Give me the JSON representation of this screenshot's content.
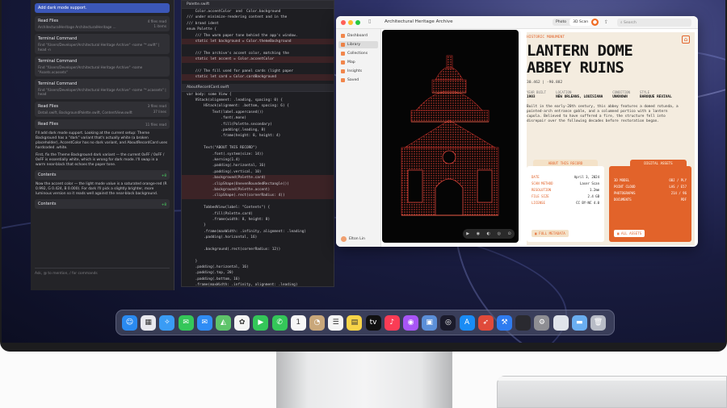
{
  "chat": {
    "prompt": "Add dark mode support.",
    "cards": [
      {
        "title": "Read Files",
        "meta": "4 files read",
        "code": "ArchitecturalHeritage ArchitecturalHeritage ...",
        "meta2": "1 items"
      },
      {
        "title": "Terminal Command",
        "code": "Find \"/Users/Developer/Architectural Heritage Archive\" -name \"*.swift\" | head -n"
      },
      {
        "title": "Terminal Command",
        "code": "Find \"/Users/Developer/Architectural Heritage Archive\" -name \"Assets.xcassets\""
      },
      {
        "title": "Terminal Command",
        "code": "Find \"/Users/Developer/Architectural Heritage Archive\" -name \"*.xcassets\" | head"
      },
      {
        "title": "Read Files",
        "meta": "3 files read",
        "code": "Detail.swift, BackgroundPalette.swift, ContentView.swift",
        "meta2": "37 lines"
      },
      {
        "title": "Read Files",
        "meta": "11 files read"
      }
    ],
    "para1": "I'll add dark mode support. Looking at the current setup: Theme Background has a \"dark\" variant that's actually white (a broken placeholder), AccentColor has no dark variant, and AboutRecordCard uses hardcoded .white.",
    "para2": "First, fix the Theme Background dark variant — the current 0xFF / 0xFF / 0xFF is essentially white, which is wrong for dark mode. I'll swap in a warm near-black that echoes the paper tone.",
    "contents1": "Contents",
    "contents1_meta": "+8",
    "para3": "Now the accent color — the light mode value is a saturated orange-red (R 0.992, G 0.424, B 0.000). For dark I'll pick a slightly brighter, more luminous version so it reads well against the near-black background.",
    "contents2": "Contents",
    "contents2_meta": "+8",
    "input_placeholder": "Ask, @ to mention, / for commands"
  },
  "editor": {
    "tab1": "Palette.swift",
    "tab2": "AboutRecordCard.swift",
    "lines1": [
      "    Color.accentColor  and  Color.background",
      "/// under minimize-rendering content and in the",
      "/// brand ident",
      "enum Palette {",
      "    /// The warm paper tone behind the app's window.",
      "    static let background = Color.themeBackground",
      "",
      "    /// The archive's accent color, matching the",
      "    static let accent = Color.accentColor",
      "",
      "    /// The fill used for panel cards (light paper",
      "    static let card = Color.cardBackground"
    ],
    "lines2": [
      "var body: some View {",
      "    VStack(alignment: .leading, spacing: 0) {",
      "        HStack(alignment: .bottom, spacing: 6) {",
      "            Text(label.uppercased())",
      "                .font(.mono)",
      "                .fill(Palette.secondary)",
      "                .padding(.leading, 8)",
      "                .frame(height: 8, height: 4)",
      "",
      "        Text(\"ABOUT THIS RECORD\")",
      "            .font(.system(size: 14))",
      "            .kerning(1.4)",
      "            .padding(.horizontal, 16)",
      "            .padding(.vertical, 10)",
      "            .background(Palette.card)",
      "            .clipShape(UnevenRoundedRectangle())",
      "            .background(Palette.accent)",
      "            .clipShape(.rect(cornerRadius: 4))",
      "",
      "        TabbedView(label: \"Contents\") {",
      "            .fill(Palette.card)",
      "            .frame(width: 8, height: 8)",
      "        }",
      "        .frame(maxWidth: .infinity, alignment: .leading)",
      "        .padding(.horizontal, 16)",
      "",
      "        .background(.rect(cornerRadius: 12))",
      "",
      "    }",
      "    .padding(.horizontal, 16)",
      "    .padding(.top, 20)",
      "    .padding(.bottom, 16)",
      "    .frame(maxWidth: .infinity, alignment: .leading)",
      "    .background(Palette.card)",
      "    .background(Palette.accent)",
      "}",
      ".foregroundStyle(.fill)"
    ]
  },
  "window": {
    "title": "Architectural Heritage Archive",
    "seg_photo": "Photo",
    "seg_scan": "3D Scan",
    "search_placeholder": "Search",
    "sidebar": [
      "Dashboard",
      "Library",
      "Collections",
      "Map",
      "Insights",
      "Saved"
    ],
    "user": "Elton Lin",
    "tools": [
      "▶",
      "◉",
      "◐",
      "◎",
      "⊙"
    ]
  },
  "detail": {
    "kicker": "HISTORIC MONUMENT",
    "title_line1": "LANTERN DOME",
    "title_line2": "ABBEY RUINS",
    "coord": "30.462 | -90.882",
    "meta": [
      {
        "k": "YEAR BUILT",
        "v": "1903"
      },
      {
        "k": "LOCATION",
        "v": "NEW ORLEANS, LOUISIANA"
      },
      {
        "k": "CONDITION",
        "v": "UNKNOWN"
      },
      {
        "k": "STYLE",
        "v": "BAROQUE REVIVAL"
      }
    ],
    "description": "Built in the early-20th century, this abbey features a domed rotunda, a pointed-arch entrance gable, and a columned portico with a lantern cupola. Believed to have suffered a fire, the structure fell into disrepair over the following decades before restoration began.",
    "about_tab": "ABOUT THIS RECORD",
    "about_rows": [
      {
        "k": "DATE",
        "v": "April 3, 2024"
      },
      {
        "k": "SCAN METHOD",
        "v": "Laser Scan"
      },
      {
        "k": "RESOLUTION",
        "v": "1.2mm"
      },
      {
        "k": "FILE SIZE",
        "v": "2.4 GB"
      },
      {
        "k": "LICENSE",
        "v": "CC BY-NC 4.0"
      }
    ],
    "about_button": "FULL METADATA",
    "assets_tab": "DIGITAL ASSETS",
    "assets_rows": [
      {
        "k": "3D MODEL",
        "v": "OBJ / PLY"
      },
      {
        "k": "POINT CLOUD",
        "v": "LAS / E57"
      },
      {
        "k": "PHOTOGRAPHS",
        "v": "214 / 96"
      },
      {
        "k": "DOCUMENTS",
        "v": "PDF"
      }
    ],
    "assets_button": "ALL ASSETS"
  },
  "dock": {
    "apps": [
      {
        "name": "finder-icon",
        "glyph": "☺",
        "color": "#2a8af0"
      },
      {
        "name": "launchpad-icon",
        "glyph": "▦",
        "color": "#e8e8ee"
      },
      {
        "name": "safari-icon",
        "glyph": "✧",
        "color": "#3a9cf5"
      },
      {
        "name": "messages-icon",
        "glyph": "✉",
        "color": "#34c759"
      },
      {
        "name": "mail-icon",
        "glyph": "✉",
        "color": "#2f8cf5"
      },
      {
        "name": "maps-icon",
        "glyph": "◭",
        "color": "#5ec46a"
      },
      {
        "name": "photos-icon",
        "glyph": "✿",
        "color": "#f4f4f4"
      },
      {
        "name": "facetime-icon",
        "glyph": "▶",
        "color": "#34c759"
      },
      {
        "name": "phone-icon",
        "glyph": "✆",
        "color": "#34c759"
      },
      {
        "name": "calendar-icon",
        "glyph": "1",
        "color": "#f6f6f6"
      },
      {
        "name": "contacts-icon",
        "glyph": "◔",
        "color": "#c9a77a"
      },
      {
        "name": "reminders-icon",
        "glyph": "☰",
        "color": "#f4f4f4"
      },
      {
        "name": "notes-icon",
        "glyph": "▤",
        "color": "#f7d448"
      },
      {
        "name": "tv-icon",
        "glyph": "tv",
        "color": "#111111"
      },
      {
        "name": "music-icon",
        "glyph": "♪",
        "color": "#fa3c55"
      },
      {
        "name": "podcasts-icon",
        "glyph": "◉",
        "color": "#a855f7"
      },
      {
        "name": "preview-icon",
        "glyph": "▣",
        "color": "#5b8fd8"
      },
      {
        "name": "activity-icon",
        "glyph": "◎",
        "color": "#1b1b2b"
      },
      {
        "name": "app-store-icon",
        "glyph": "A",
        "color": "#1a8cf5"
      },
      {
        "name": "instruments-icon",
        "glyph": "➶",
        "color": "#e04a3a"
      },
      {
        "name": "xcode-icon",
        "glyph": "⚒",
        "color": "#2f7cf0"
      },
      {
        "name": "blank-icon",
        "glyph": "",
        "color": "#2a2a30"
      },
      {
        "name": "system-settings-icon",
        "glyph": "⚙",
        "color": "#8e8e93"
      },
      {
        "name": "window-icon",
        "glyph": "",
        "color": "#e0e4ea"
      },
      {
        "name": "folder-icon",
        "glyph": "▬",
        "color": "#6aaef0"
      },
      {
        "name": "trash-icon",
        "glyph": "🗑",
        "color": "#b8bcc6"
      }
    ]
  }
}
